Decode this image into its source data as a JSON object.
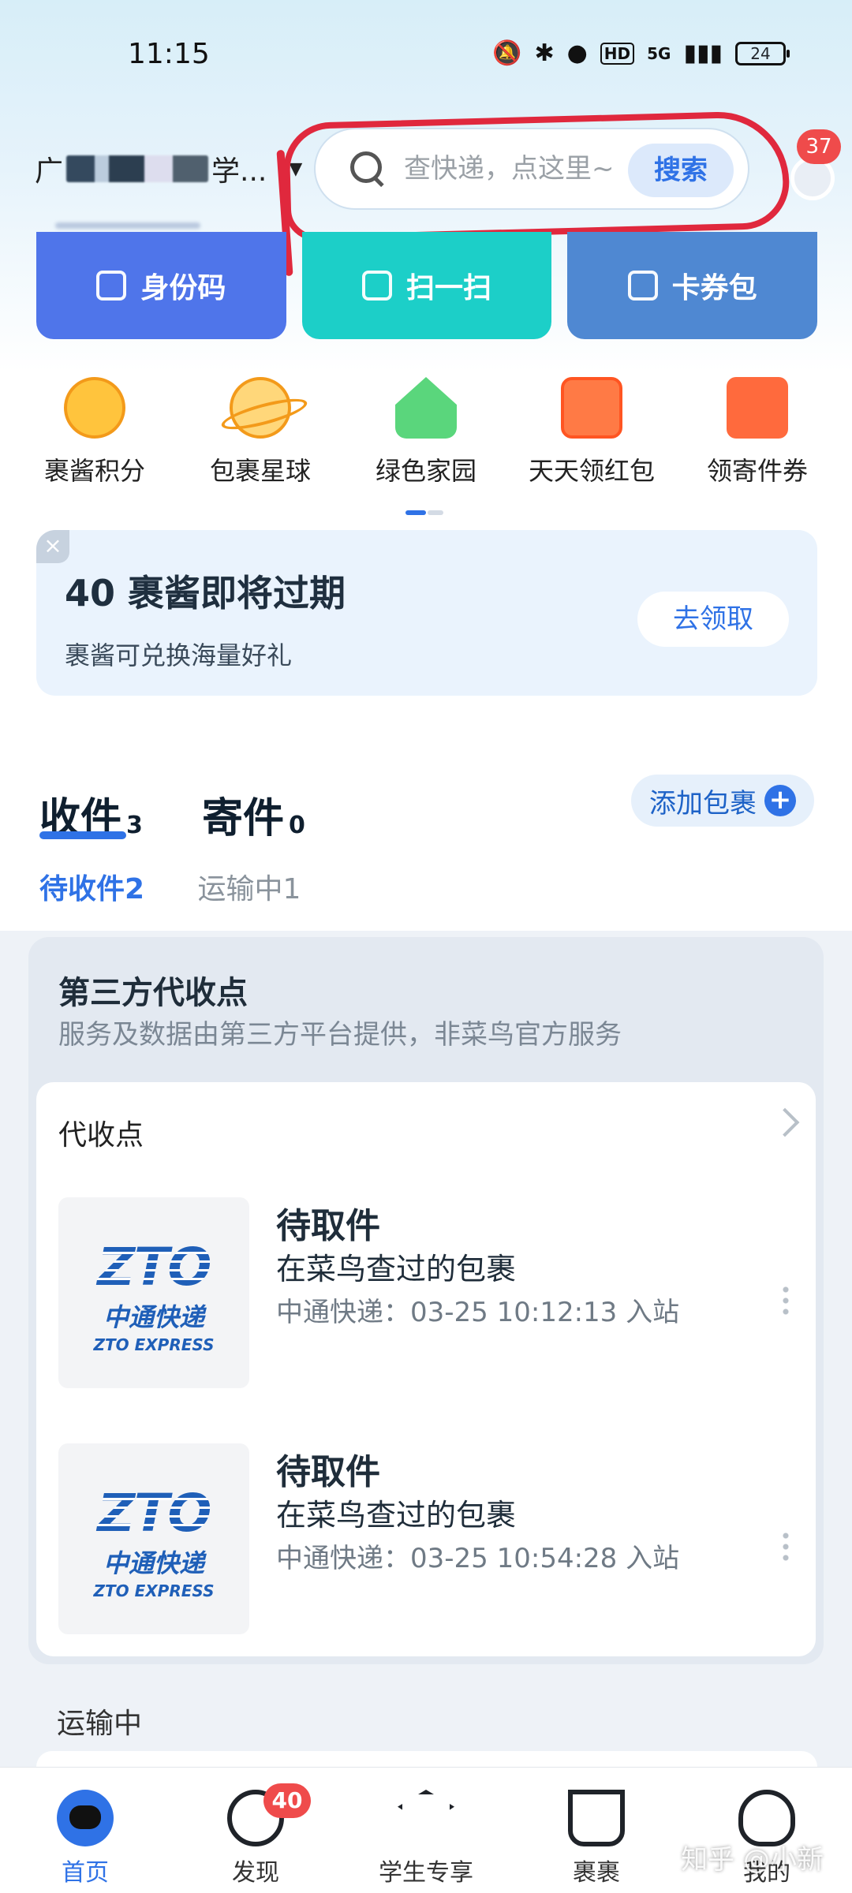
{
  "status": {
    "time": "11:15",
    "hd": "HD",
    "net": "5G",
    "battery": "24"
  },
  "header": {
    "location_prefix": "广",
    "location_suffix": "学...",
    "search_placeholder": "查快递，点这里~",
    "search_button": "搜索",
    "msg_badge": "37"
  },
  "quick_actions": [
    {
      "label": "身份码"
    },
    {
      "label": "扫一扫"
    },
    {
      "label": "卡券包"
    }
  ],
  "services": [
    {
      "label": "裹酱积分",
      "icon": "smiley-icon"
    },
    {
      "label": "包裹星球",
      "icon": "planet-icon"
    },
    {
      "label": "绿色家园",
      "icon": "green-house-icon"
    },
    {
      "label": "天天领红包",
      "icon": "red-packet-icon"
    },
    {
      "label": "领寄件券",
      "icon": "coupon-icon"
    }
  ],
  "promo": {
    "close": "×",
    "title": "40 裹酱即将过期",
    "subtitle": "裹酱可兑换海量好礼",
    "button": "去领取"
  },
  "tabs": {
    "receive": {
      "label": "收件",
      "count": "3"
    },
    "send": {
      "label": "寄件",
      "count": "0"
    },
    "add_package": "添加包裹",
    "plus": "+"
  },
  "subtabs": {
    "pending": "待收件2",
    "transit": "运输中1"
  },
  "third_party": {
    "title": "第三方代收点",
    "desc": "服务及数据由第三方平台提供，非菜鸟官方服务",
    "section": "代收点",
    "packages": [
      {
        "status": "待取件",
        "desc": "在菜鸟查过的包裹",
        "info": "中通快递：03-25 10:12:13 入站",
        "logo": "ZTO",
        "logo_cn": "中通快递",
        "logo_en": "ZTO EXPRESS"
      },
      {
        "status": "待取件",
        "desc": "在菜鸟查过的包裹",
        "info": "中通快递：03-25 10:54:28 入站",
        "logo": "ZTO",
        "logo_cn": "中通快递",
        "logo_en": "ZTO EXPRESS"
      }
    ]
  },
  "transit_title": "运输中",
  "bottom_nav": [
    {
      "label": "首页",
      "icon": "home-icon"
    },
    {
      "label": "发现",
      "icon": "discover-icon",
      "badge": "40"
    },
    {
      "label": "学生专享",
      "icon": "graduation-cap-icon"
    },
    {
      "label": "裹裹",
      "icon": "basket-icon"
    },
    {
      "label": "我的",
      "icon": "person-icon"
    }
  ],
  "watermark": "知乎 @小新"
}
